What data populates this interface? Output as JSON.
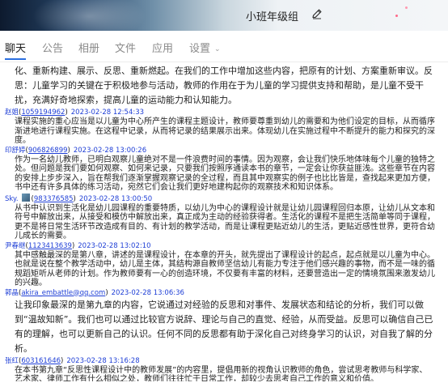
{
  "group": {
    "title": "小班年级组"
  },
  "tabs": [
    {
      "label": "聊天"
    },
    {
      "label": "公告"
    },
    {
      "label": "相册"
    },
    {
      "label": "文件"
    },
    {
      "label": "应用"
    },
    {
      "label": "设置"
    }
  ],
  "partial_top": "化、重新构建、展示、反思、重新燃起。在我们的工作中增加这些内容，把原有的计划、方案重新审议。反思：儿童学习的关键在于积极地参与活动，教师的作用在于为儿童的学习提供支持和帮助，是儿童不受干扰，充满好奇地探索，提高儿童的运动能力和认知能力。",
  "messages": [
    {
      "sender": "赵姐",
      "qq": "1059194962",
      "time": "2023-02-28 12:54:33",
      "text": "课程实施的重心应当是以儿童为中心所产生的课程主题设计，教师要尊重到幼儿的需要和为他们设定的目标，从而循序渐进地进行课程实施。在这程中记录，从而将记录的结果展示出来。体现幼儿在实施过程中不断提升的能力和探究的深度。"
    },
    {
      "sender": "印舒婷",
      "qq": "906826899",
      "time": "2023-02-28 13:00:26",
      "text": "作为一名幼儿教师，已明白观察儿童绝对不是一件浪费时间的事情。因为观察，会让我们快乐地体味每个儿童的独特之处。但问题是我们要如何观察、如何来记录，只要我们按照序通读本书的章节，一定会让你获益匪浅。这些章节在内容的安排上步步深入，旨在帮我们逐渐掌握观察记录的全过程，而且其中观察实的例子也比比皆是，查找起来更加方便，书中还有许多具体的练习活动，宛然它们会让我们更好地建构起你的观察技术和知识体系。"
    },
    {
      "sender": "Sky.",
      "qq": "983376585",
      "time": "2023-02-28 13:00:50",
      "text": "从书中认识到生活化是幼儿园课程的重要特质，以幼儿为中心的课程设计就是让幼儿园课程回归本原，让幼儿从文本和符号中解放出来，从接受和模仿中解放出来，真正成为主动的经验获得者。生活化的课程不是把生活简单等同于课程，更不是将日常生活环节改造成有目的、有计划的教学活动，而是让课程更贴近幼儿的生活，更贴近感性世界，更符合幼儿成长的需要。"
    },
    {
      "sender": "尹春继",
      "qq": "1123413639",
      "time": "2023-02-28 13:02:10",
      "text": "其中感触最深的是第八章，讲述的是课程设计，在本章的开头，就先提出了课程设计的起点，起点就是以儿童为中心。也就是说在整个教学活动中，幼儿是主体，其结构源自教师坚信幼儿有能力专注于他们感兴趣的事物，而不是一味的循规蹈矩听从老师的计划。作为教师要有一心的创造环境，不仅要有丰富的材料，还要营造出一定的情境氛围来激发幼儿的兴趣。"
    },
    {
      "sender": "郭晶",
      "qq": "akira_embattle@qq.com",
      "time": "2023-02-28 13:06:36",
      "text": "让我印象最深的是第九章的内容，它说通过对经验的反思和对事件、发展状态和结论的分析，我们可以做到“温故知新”。我们也可以通过比较官方说辞、理论与自己的直觉、经验，从而受益。反思可以确信自己已有的理解，也可以更新自己的认识。任何不同的反思都有助于深化自己对终身学习的认识，对自我了解的分析。"
    },
    {
      "sender": "张红",
      "qq": "603161646",
      "time": "2023-02-28 13:16:28",
      "text": "在本书第九章“反思性课程设计中的教师发展”的内容里，提倡用新的视角认识教师的角色，尝试思考教师与科学家、艺术家、律师工作有什么相似之处，教师们往往忙于日常工作，却较少去思考自己工作的意义和价值。"
    }
  ],
  "colors": {
    "accent": "#2b6fe0",
    "link": "#1f3fd6"
  },
  "icons": {
    "edit": "pencil-icon",
    "avatar": "avatar-thumbnail",
    "settings_chevron": "chevron-down-icon"
  }
}
